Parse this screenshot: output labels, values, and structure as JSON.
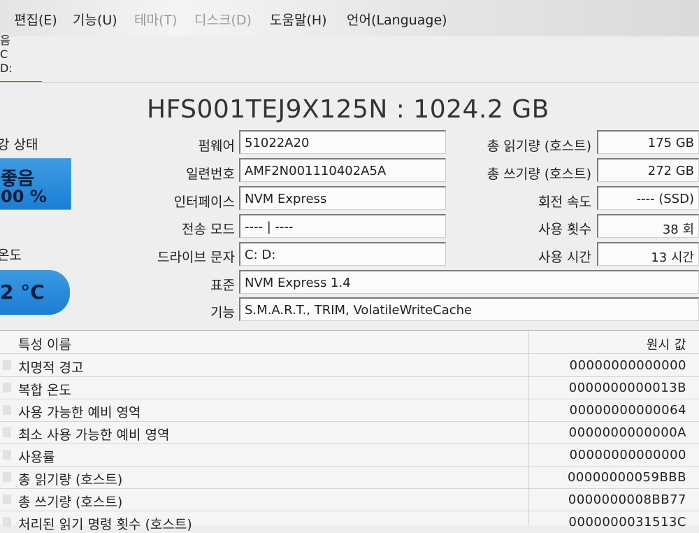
{
  "menu": [
    {
      "label": "편집(E)",
      "dim": false
    },
    {
      "label": "기능(U)",
      "dim": false
    },
    {
      "label": "테마(T)",
      "dim": true
    },
    {
      "label": "디스크(D)",
      "dim": true
    },
    {
      "label": "도움말(H)",
      "dim": false
    },
    {
      "label": "언어(Language)",
      "dim": false
    }
  ],
  "drive_strip": [
    "음",
    "C",
    "D:"
  ],
  "title": "HFS001TEJ9X125N : 1024.2 GB",
  "health": {
    "label": "강 상태",
    "status": "좋음",
    "percent": "00 %"
  },
  "temperature": {
    "label": "온도",
    "value": "2 °C"
  },
  "info_left": [
    {
      "label": "펌웨어",
      "value": "51022A20"
    },
    {
      "label": "일련번호",
      "value": "AMF2N001110402A5A"
    },
    {
      "label": "인터페이스",
      "value": "NVM Express"
    },
    {
      "label": "전송 모드",
      "value": "---- | ----"
    },
    {
      "label": "드라이브 문자",
      "value": "C: D:"
    }
  ],
  "info_right": [
    {
      "label": "총 읽기량 (호스트)",
      "value": "175 GB"
    },
    {
      "label": "총 쓰기량 (호스트)",
      "value": "272 GB"
    },
    {
      "label": "회전 속도",
      "value": "---- (SSD)"
    },
    {
      "label": "사용 횟수",
      "value": "38 회"
    },
    {
      "label": "사용 시간",
      "value": "13 시간"
    }
  ],
  "info_wide": [
    {
      "label": "표준",
      "value": "NVM Express 1.4"
    },
    {
      "label": "기능",
      "value": "S.M.A.R.T., TRIM, VolatileWriteCache"
    }
  ],
  "table": {
    "headers": {
      "name": "특성 이름",
      "raw": "원시 값"
    },
    "rows": [
      {
        "name": "치명적 경고",
        "raw": "00000000000000"
      },
      {
        "name": "복합 온도",
        "raw": "0000000000013B"
      },
      {
        "name": "사용 가능한 예비 영역",
        "raw": "00000000000064"
      },
      {
        "name": "최소 사용 가능한 예비 영역",
        "raw": "0000000000000A"
      },
      {
        "name": "사용률",
        "raw": "00000000000000"
      },
      {
        "name": "총 읽기량 (호스트)",
        "raw": "00000000059BBB"
      },
      {
        "name": "총 쓰기량 (호스트)",
        "raw": "0000000008BB77"
      },
      {
        "name": "처리된 읽기 명령 횟수 (호스트)",
        "raw": "0000000031513C"
      }
    ]
  },
  "colors": {
    "accent": "#1a7fd6",
    "underline": "#3a6fcf"
  }
}
